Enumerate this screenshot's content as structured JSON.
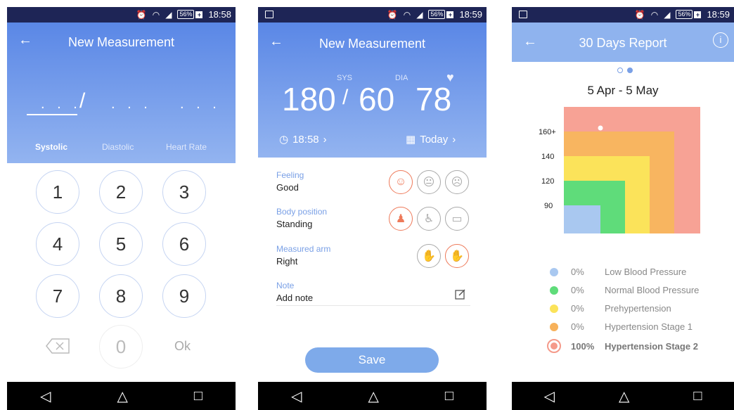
{
  "screens": [
    {
      "status_time": "18:58",
      "battery": "56%",
      "title": "New Measurement",
      "fields": {
        "systolic": "Systolic",
        "diastolic": "Diastolic",
        "heart_rate": "Heart Rate"
      },
      "placeholder": ". . .",
      "keys": [
        "1",
        "2",
        "3",
        "4",
        "5",
        "6",
        "7",
        "8",
        "9",
        "0"
      ],
      "ok_label": "Ok"
    },
    {
      "status_time": "18:59",
      "battery": "56%",
      "title": "New Measurement",
      "sys_label": "SYS",
      "dia_label": "DIA",
      "sys_value": "180",
      "dia_value": "60",
      "pulse_value": "78",
      "slash": "/",
      "time": "18:58",
      "date": "Today",
      "rows": [
        {
          "label": "Feeling",
          "value": "Good"
        },
        {
          "label": "Body position",
          "value": "Standing"
        },
        {
          "label": "Measured arm",
          "value": "Right"
        },
        {
          "label": "Note",
          "value": "Add note"
        }
      ],
      "save_label": "Save"
    },
    {
      "status_time": "18:59",
      "battery": "56%",
      "title": "30 Days Report",
      "range": "5 Apr - 5 May",
      "yticks": [
        "160+",
        "140",
        "120",
        "90"
      ],
      "legend": [
        {
          "pct": "0%",
          "label": "Low Blood Pressure",
          "color": "#a9c8f0"
        },
        {
          "pct": "0%",
          "label": "Normal Blood Pressure",
          "color": "#5fdc7a"
        },
        {
          "pct": "0%",
          "label": "Prehypertension",
          "color": "#fbe35a"
        },
        {
          "pct": "0%",
          "label": "Hypertension Stage 1",
          "color": "#f7b15a"
        },
        {
          "pct": "100%",
          "label": "Hypertension Stage 2",
          "color": "#f59a8a"
        }
      ]
    }
  ],
  "colors": {
    "header_top": "#5a87e6",
    "header_bottom": "#93b4f0",
    "statusbar": "#1e2556",
    "accent": "#ee7a5a"
  }
}
